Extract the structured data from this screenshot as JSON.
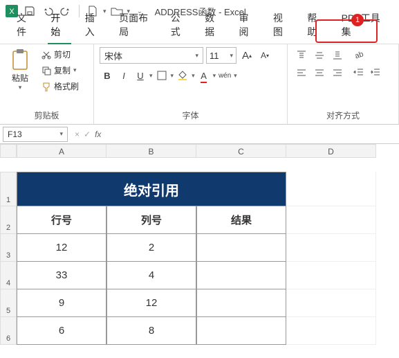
{
  "title": "ADDRESS函数  -  Excel",
  "qa": {
    "save": "保存"
  },
  "menu": [
    "文件",
    "开始",
    "插入",
    "页面布局",
    "公式",
    "数据",
    "审阅",
    "视图",
    "帮助",
    "PDF工具集"
  ],
  "menu_active": 1,
  "callout": "1",
  "ribbon": {
    "clipboard": {
      "label": "剪贴板",
      "paste": "粘贴",
      "cut": "剪切",
      "copy": "复制",
      "fmt": "格式刷"
    },
    "font": {
      "label": "字体",
      "name": "宋体",
      "size": "11",
      "grow": "A",
      "shrink": "A",
      "bold": "B",
      "italic": "I",
      "underline": "U",
      "wen": "wén"
    },
    "align": {
      "label": "对齐方式"
    }
  },
  "namebox": "F13",
  "fx_x": "×",
  "fx_v": "✓",
  "fx": "fx",
  "cols": [
    "A",
    "B",
    "C",
    "D"
  ],
  "rownums": [
    "1",
    "2",
    "3",
    "4",
    "5",
    "6"
  ],
  "merged_title": "绝对引用",
  "headers": [
    "行号",
    "列号",
    "结果"
  ],
  "rows": [
    [
      "12",
      "2",
      ""
    ],
    [
      "33",
      "4",
      ""
    ],
    [
      "9",
      "12",
      ""
    ],
    [
      "6",
      "8",
      ""
    ]
  ]
}
